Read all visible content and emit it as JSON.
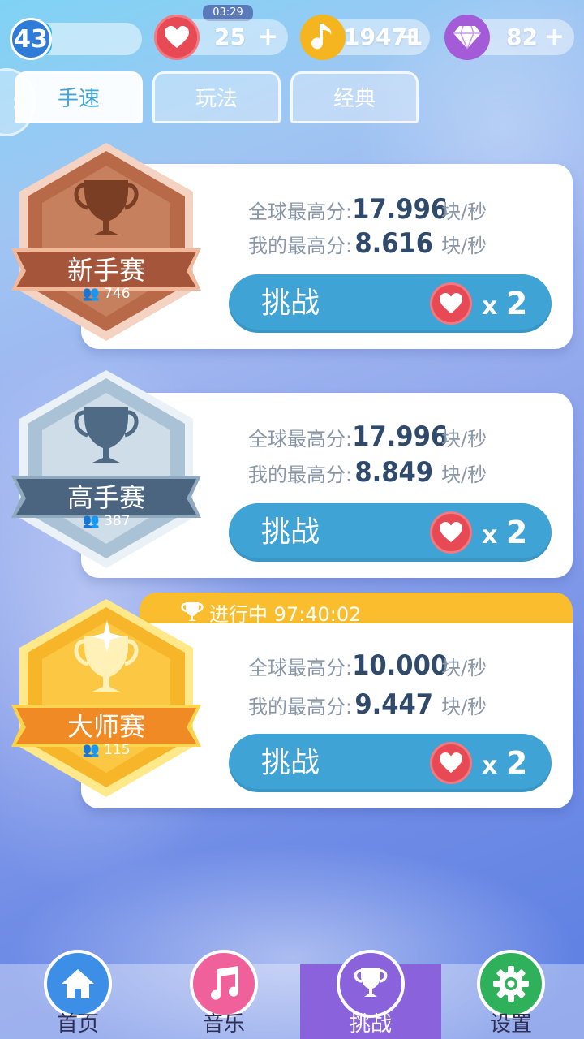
{
  "status": {
    "level": "43",
    "level_progress": 0.18,
    "timer": "03:29",
    "hearts": "25",
    "notes": "19471",
    "diamonds": "82",
    "plus": "+"
  },
  "tabs": [
    {
      "label": "手速",
      "active": true
    },
    {
      "label": "玩法",
      "active": false
    },
    {
      "label": "经典",
      "active": false
    }
  ],
  "side_arrow": "›",
  "competitions": [
    {
      "name": "新手赛",
      "players": "746",
      "global_label": "全球最高分:",
      "global_score": "17.996",
      "my_label": "我的最高分:",
      "my_score": "8.616",
      "unit": "块/秒",
      "button": "挑战",
      "cost_prefix": "x",
      "cost": "2"
    },
    {
      "name": "高手赛",
      "players": "387",
      "global_label": "全球最高分:",
      "global_score": "17.996",
      "my_label": "我的最高分:",
      "my_score": "8.849",
      "unit": "块/秒",
      "button": "挑战",
      "cost_prefix": "x",
      "cost": "2"
    },
    {
      "name": "大师赛",
      "players": "115",
      "global_label": "全球最高分:",
      "global_score": "10.000",
      "my_label": "我的最高分:",
      "my_score": "9.447",
      "unit": "块/秒",
      "button": "挑战",
      "cost_prefix": "x",
      "cost": "2",
      "live_banner": "进行中 97:40:02"
    }
  ],
  "nav": [
    {
      "label": "首页",
      "icon": "home-icon",
      "color": "#3d8ee6"
    },
    {
      "label": "音乐",
      "icon": "music-icon",
      "color": "#f0609a"
    },
    {
      "label": "挑战",
      "icon": "trophy-icon",
      "color": "#8a63dc",
      "active": true
    },
    {
      "label": "设置",
      "icon": "gear-icon",
      "color": "#2fb05a"
    }
  ],
  "colors": {
    "bronze": "#a8603f",
    "silver": "#4f6a84",
    "gold": "#f3902a",
    "button": "#3fa3d6",
    "heart": "#e84a55"
  }
}
